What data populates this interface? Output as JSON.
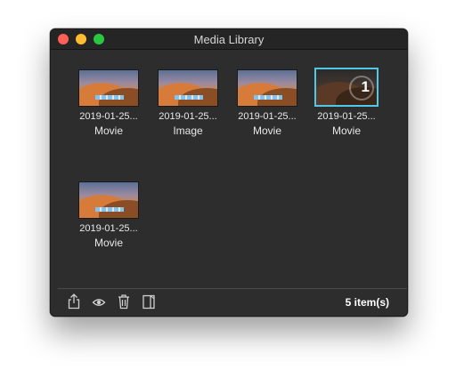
{
  "window": {
    "title": "Media Library"
  },
  "items": [
    {
      "date": "2019-01-25...",
      "type": "Movie",
      "selected": false
    },
    {
      "date": "2019-01-25...",
      "type": "Image",
      "selected": false
    },
    {
      "date": "2019-01-25...",
      "type": "Movie",
      "selected": false
    },
    {
      "date": "2019-01-25...",
      "type": "Movie",
      "selected": true,
      "badge": "1"
    },
    {
      "date": "2019-01-25...",
      "type": "Movie",
      "selected": false
    }
  ],
  "footer": {
    "icons": [
      "share-icon",
      "eye-icon",
      "trash-icon",
      "sidebar-icon"
    ],
    "count_label": "5 item(s)"
  },
  "colors": {
    "accent": "#4ec9e8",
    "background": "#2d2d2d",
    "close": "#fe5f57",
    "minimize": "#febc2e",
    "maximize": "#28c840"
  }
}
